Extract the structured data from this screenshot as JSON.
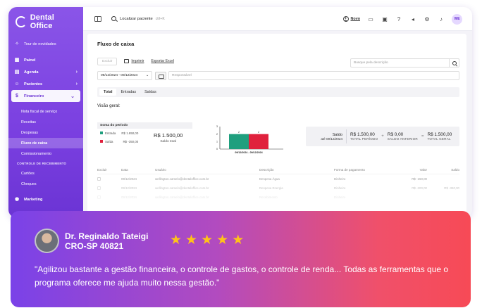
{
  "sidebar": {
    "brand": "Dental Office",
    "items": [
      {
        "label": "Tour de novidades",
        "icon": "sparkle-icon",
        "bold": false
      },
      {
        "label": "Painel",
        "icon": "dashboard-icon",
        "bold": true
      },
      {
        "label": "Agenda",
        "icon": "calendar-icon",
        "bold": true,
        "chevron": "›"
      },
      {
        "label": "Pacientes",
        "icon": "users-icon",
        "bold": true,
        "chevron": "›"
      },
      {
        "label": "Financeiro",
        "icon": "finance-icon",
        "bold": true,
        "chevron": "⌄",
        "active": true
      }
    ],
    "subitems": [
      "Nota fiscal de serviço",
      "Receitas",
      "Despesas",
      "Fluxo de caixa",
      "Comissionamento"
    ],
    "active_sub": "Fluxo de caixa",
    "section": "CONTROLE DE RECEBIMENTO",
    "section_items": [
      "Cartões",
      "Cheques"
    ],
    "bottom_item": "Marketing"
  },
  "topbar": {
    "search_label": "Localizar paciente",
    "search_shortcut": "ctrl+K",
    "novo": "Novo",
    "avatar": "WE"
  },
  "page": {
    "title": "Fluxo de caixa",
    "excluir": "Excluir",
    "imprimir": "Imprimir",
    "exportar": "Exportar Excel",
    "search_placeholder": "Busque pela descrição",
    "date_range": "09/12/2024  -  09/12/2024",
    "responsavel_placeholder": "Responsável",
    "tabs": [
      "Total",
      "Entradas",
      "Saídas"
    ],
    "active_tab": "Total",
    "visao_geral": "Visão geral:"
  },
  "soma": {
    "title": "Soma do período",
    "entrada_label": "Entrada",
    "entrada_value": "R$ 1.850,00",
    "saida_label": "Saída",
    "saida_value": "R$ -350,00",
    "total_value": "R$ 1.500,00",
    "total_label": "Saldo total"
  },
  "chart_data": {
    "type": "bar",
    "categories": [
      "09/12/2024 - 09/12/2024"
    ],
    "series": [
      {
        "values": [
          2
        ],
        "color": "#1f9f7e"
      },
      {
        "values": [
          2
        ],
        "color": "#e0213d"
      }
    ],
    "data_labels": [
      "2",
      "2"
    ],
    "yticks": [
      "3",
      "2",
      "1",
      "0"
    ],
    "ylim": [
      0,
      3
    ]
  },
  "summary": {
    "saldo_label": "Saldo",
    "saldo_date": "até 09/12/2024",
    "periodo_value": "R$ 1.500,00",
    "periodo_label": "TOTAL PERÍODO",
    "plus": "+",
    "anterior_value": "R$ 0,00",
    "anterior_label": "SALDO ANTERIOR",
    "equals": "=",
    "geral_value": "R$ 1.500,00",
    "geral_label": "TOTAL GERAL"
  },
  "table": {
    "headers": [
      "Excluir",
      "Data",
      "Usuário",
      "Descrição",
      "Forma de pagamento",
      "Valor",
      "Saldo"
    ],
    "rows": [
      {
        "date": "09/12/2024",
        "user": "wellington.camelo@dentaloffice.com.br",
        "desc": "Despesa Água",
        "pay": "Dinheiro",
        "value": "R$ -150,00",
        "saldo": ""
      },
      {
        "date": "09/12/2024",
        "user": "wellington.camelo@dentaloffice.com.br",
        "desc": "Despesa Energia",
        "pay": "Dinheiro",
        "value": "R$ -200,00",
        "saldo": "R$ -350,00"
      },
      {
        "date": "09/12/2024",
        "user": "wellington.camelo@dentaloffice.com.br",
        "desc": "Recebimento",
        "pay": "Dinheiro",
        "value": "",
        "saldo": ""
      }
    ]
  },
  "testimonial": {
    "name": "Dr. Reginaldo Tateigi",
    "registry": "CRO-SP 40821",
    "stars": [
      "★",
      "★",
      "★",
      "★",
      "★"
    ],
    "quote": "\"Agilizou bastante a gestão financeira, o controle de gastos, o controle de renda... Todas as ferramentas que o programa oferece me ajuda muito nessa gestão.\""
  }
}
